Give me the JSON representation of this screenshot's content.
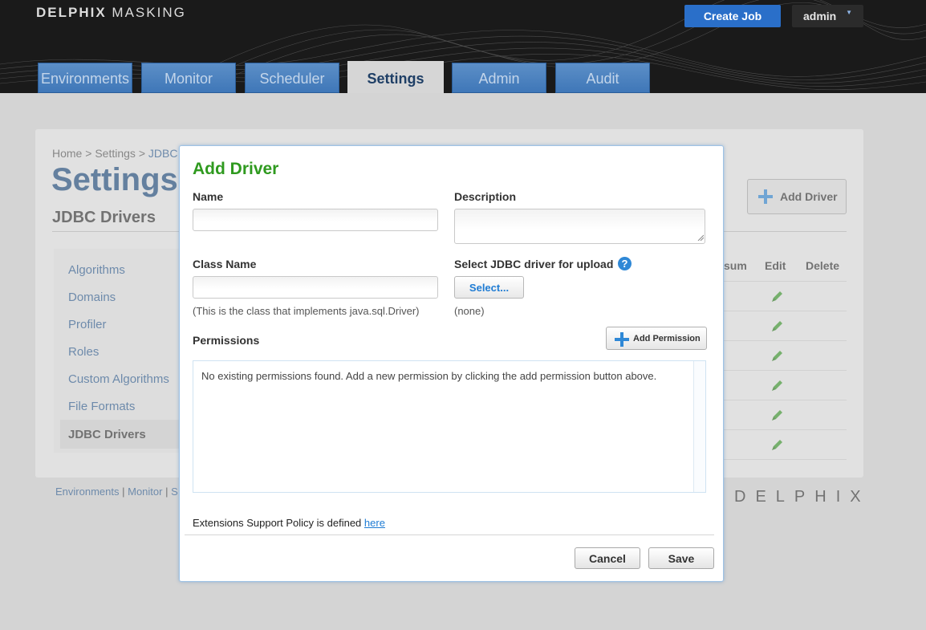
{
  "header": {
    "logo_bold": "DELPHIX",
    "logo_light": "MASKING",
    "create_job_label": "Create Job",
    "user_label": "admin",
    "tabs": [
      {
        "label": "Environments"
      },
      {
        "label": "Monitor"
      },
      {
        "label": "Scheduler"
      },
      {
        "label": "Settings"
      },
      {
        "label": "Admin"
      },
      {
        "label": "Audit"
      }
    ],
    "active_tab": "Settings"
  },
  "page": {
    "breadcrumb_home": "Home",
    "breadcrumb_settings": "Settings",
    "breadcrumb_current": "JDBC",
    "breadcrumb_sep": ">",
    "title": "Settings",
    "section_title": "JDBC Drivers",
    "add_driver_label": "Add Driver",
    "sidebar": [
      {
        "label": "Algorithms"
      },
      {
        "label": "Domains"
      },
      {
        "label": "Profiler"
      },
      {
        "label": "Roles"
      },
      {
        "label": "Custom Algorithms"
      },
      {
        "label": "File Formats"
      },
      {
        "label": "JDBC Drivers"
      }
    ],
    "table_headers": {
      "checksum_partial": "sum",
      "edit": "Edit",
      "delete": "Delete"
    },
    "footer_links": {
      "environments": "Environments",
      "monitor": "Monitor",
      "partial": "S",
      "sep": "|"
    },
    "footer_logo": "DELPHIX"
  },
  "modal": {
    "title": "Add Driver",
    "name_label": "Name",
    "name_value": "",
    "description_label": "Description",
    "description_value": "",
    "class_name_label": "Class Name",
    "class_name_value": "",
    "class_name_hint": "(This is the class that implements java.sql.Driver)",
    "upload_label": "Select JDBC driver for upload",
    "help_glyph": "?",
    "select_button": "Select...",
    "selected_file": "(none)",
    "permissions_label": "Permissions",
    "add_permission_label": "Add Permission",
    "permissions_empty": "No existing permissions found. Add a new permission by clicking the add permission button above.",
    "policy_text": "Extensions Support Policy is defined",
    "policy_link": "here",
    "cancel_label": "Cancel",
    "save_label": "Save"
  },
  "colors": {
    "brand_blue": "#2a6fc9",
    "tab_blue": "#4a7fbd",
    "title_green": "#2f9a1f",
    "link_blue": "#1f7cd4",
    "edit_green": "#3a9a2a"
  },
  "icons": [
    "plus-icon",
    "question-icon",
    "pencil-icon",
    "chevron-down-icon"
  ]
}
